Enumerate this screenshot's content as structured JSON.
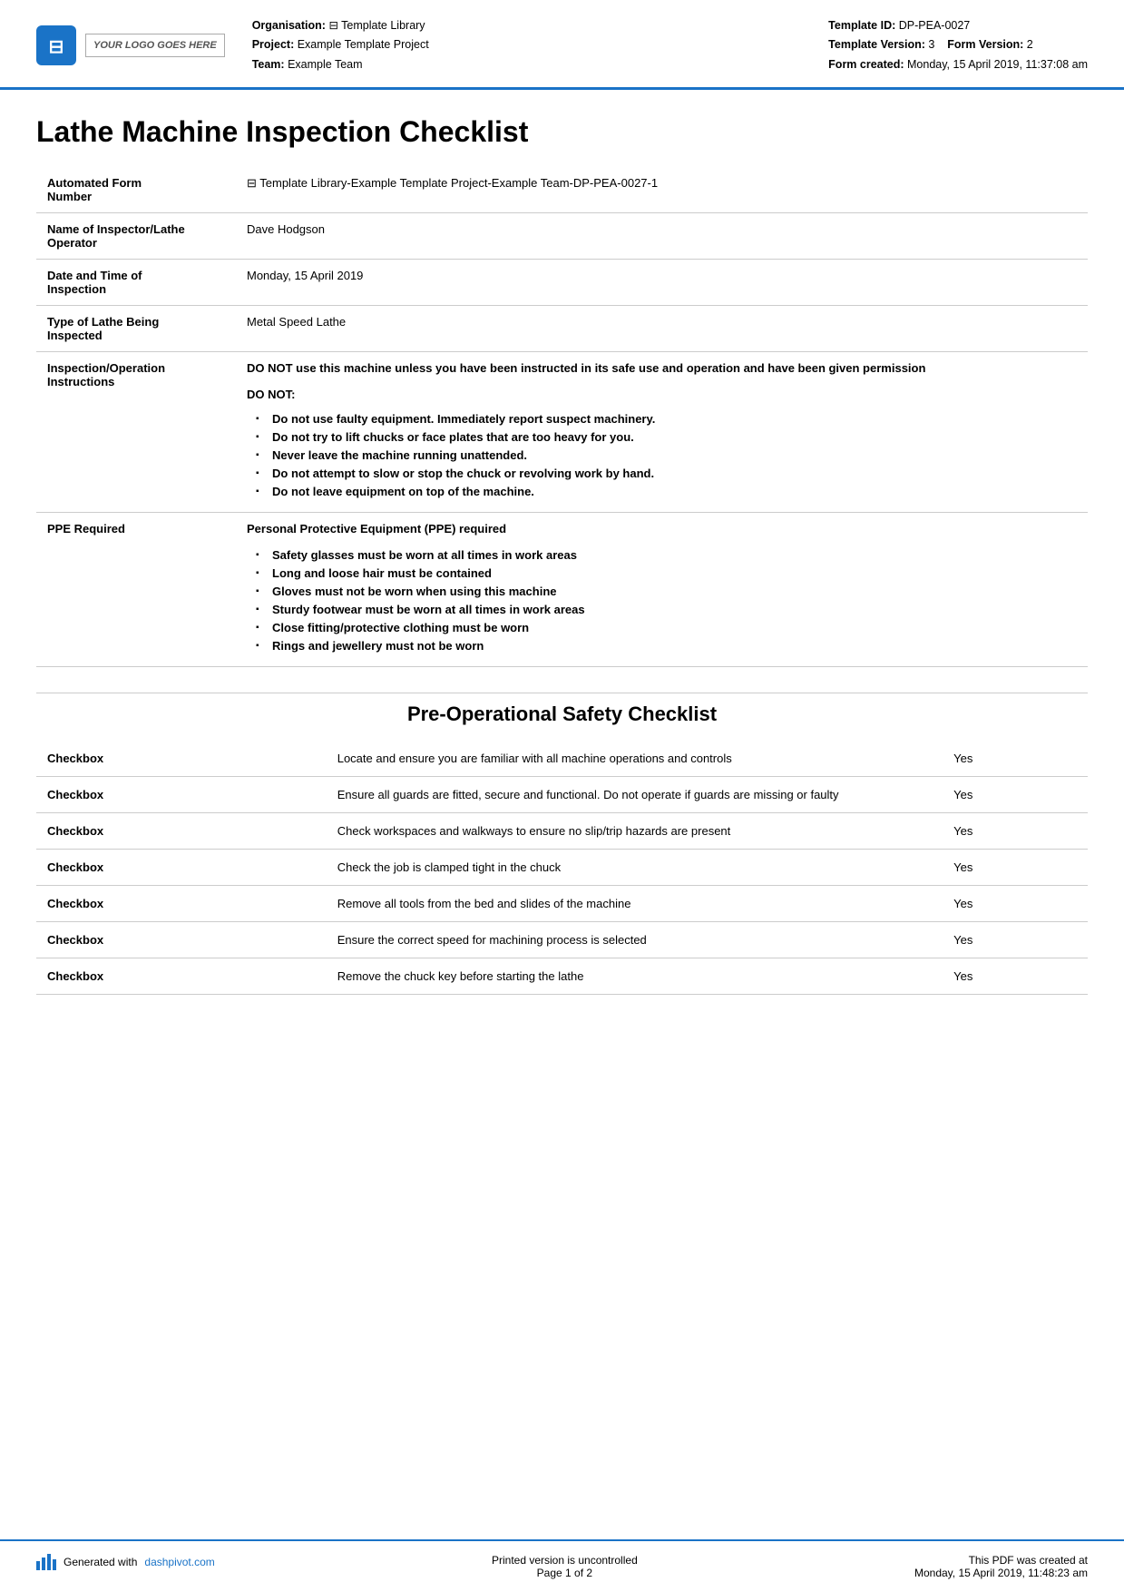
{
  "header": {
    "logo_text": "YOUR LOGO GOES HERE",
    "org_label": "Organisation:",
    "org_value": "⊟ Template Library",
    "project_label": "Project:",
    "project_value": "Example Template Project",
    "team_label": "Team:",
    "team_value": "Example Team",
    "template_id_label": "Template ID:",
    "template_id_value": "DP-PEA-0027",
    "template_version_label": "Template Version:",
    "template_version_value": "3",
    "form_version_label": "Form Version:",
    "form_version_value": "2",
    "form_created_label": "Form created:",
    "form_created_value": "Monday, 15 April 2019, 11:37:08 am"
  },
  "document": {
    "title": "Lathe Machine Inspection Checklist"
  },
  "info_rows": [
    {
      "label": "Automated Form Number",
      "value": "⊟ Template Library-Example Template Project-Example Team-DP-PEA-0027-1"
    },
    {
      "label": "Name of Inspector/Lathe Operator",
      "value": "Dave Hodgson"
    },
    {
      "label": "Date and Time of Inspection",
      "value": "Monday, 15 April 2019"
    },
    {
      "label": "Type of Lathe Being Inspected",
      "value": "Metal Speed Lathe"
    },
    {
      "label": "Inspection/Operation Instructions",
      "value_bold": "DO NOT use this machine unless you have been instructed in its safe use and operation and have been given permission",
      "do_not_label": "DO NOT:",
      "bullets": [
        "Do not use faulty equipment. Immediately report suspect machinery.",
        "Do not try to lift chucks or face plates that are too heavy for you.",
        "Never leave the machine running unattended.",
        "Do not attempt to slow or stop the chuck or revolving work by hand.",
        "Do not leave equipment on top of the machine."
      ]
    },
    {
      "label": "PPE Required",
      "value_bold": "Personal Protective Equipment (PPE) required",
      "ppe_bullets": [
        "Safety glasses must be worn at all times in work areas",
        "Long and loose hair must be contained",
        "Gloves must not be worn when using this machine",
        "Sturdy footwear must be worn at all times in work areas",
        "Close fitting/protective clothing must be worn",
        "Rings and jewellery must not be worn"
      ]
    }
  ],
  "pre_operational": {
    "title": "Pre-Operational Safety Checklist",
    "checklist": [
      {
        "label": "Checkbox",
        "description": "Locate and ensure you are familiar with all machine operations and controls",
        "value": "Yes"
      },
      {
        "label": "Checkbox",
        "description": "Ensure all guards are fitted, secure and functional. Do not operate if guards are missing or faulty",
        "value": "Yes"
      },
      {
        "label": "Checkbox",
        "description": "Check workspaces and walkways to ensure no slip/trip hazards are present",
        "value": "Yes"
      },
      {
        "label": "Checkbox",
        "description": "Check the job is clamped tight in the chuck",
        "value": "Yes"
      },
      {
        "label": "Checkbox",
        "description": "Remove all tools from the bed and slides of the machine",
        "value": "Yes"
      },
      {
        "label": "Checkbox",
        "description": "Ensure the correct speed for machining process is selected",
        "value": "Yes"
      },
      {
        "label": "Checkbox",
        "description": "Remove the chuck key before starting the lathe",
        "value": "Yes"
      }
    ]
  },
  "footer": {
    "generated_text": "Generated with",
    "generated_link": "dashpivot.com",
    "uncontrolled_line1": "Printed version is uncontrolled",
    "uncontrolled_line2": "Page 1 of 2",
    "created_line1": "This PDF was created at",
    "created_line2": "Monday, 15 April 2019, 11:48:23 am"
  }
}
